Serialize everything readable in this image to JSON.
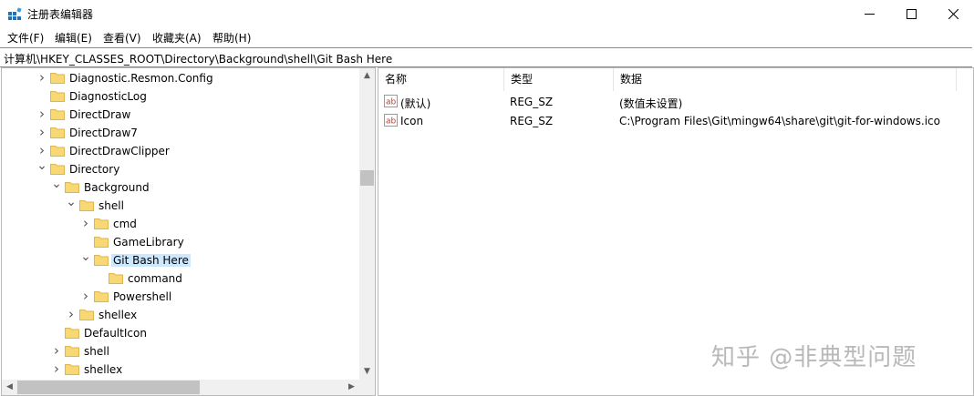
{
  "window": {
    "title": "注册表编辑器"
  },
  "menu": [
    "文件(F)",
    "编辑(E)",
    "查看(V)",
    "收藏夹(A)",
    "帮助(H)"
  ],
  "address": "计算机\\HKEY_CLASSES_ROOT\\Directory\\Background\\shell\\Git Bash Here",
  "tree": [
    {
      "label": "Diagnostic.Resmon.Config",
      "depth": 0,
      "state": "collapsed"
    },
    {
      "label": "DiagnosticLog",
      "depth": 0,
      "state": "none"
    },
    {
      "label": "DirectDraw",
      "depth": 0,
      "state": "collapsed"
    },
    {
      "label": "DirectDraw7",
      "depth": 0,
      "state": "collapsed"
    },
    {
      "label": "DirectDrawClipper",
      "depth": 0,
      "state": "collapsed"
    },
    {
      "label": "Directory",
      "depth": 0,
      "state": "expanded"
    },
    {
      "label": "Background",
      "depth": 1,
      "state": "expanded"
    },
    {
      "label": "shell",
      "depth": 2,
      "state": "expanded"
    },
    {
      "label": "cmd",
      "depth": 3,
      "state": "collapsed"
    },
    {
      "label": "GameLibrary",
      "depth": 3,
      "state": "none"
    },
    {
      "label": "Git Bash Here",
      "depth": 3,
      "state": "expanded",
      "selected": true
    },
    {
      "label": "command",
      "depth": 4,
      "state": "none"
    },
    {
      "label": "Powershell",
      "depth": 3,
      "state": "collapsed"
    },
    {
      "label": "shellex",
      "depth": 2,
      "state": "collapsed"
    },
    {
      "label": "DefaultIcon",
      "depth": 1,
      "state": "none"
    },
    {
      "label": "shell",
      "depth": 1,
      "state": "collapsed"
    },
    {
      "label": "shellex",
      "depth": 1,
      "state": "collapsed"
    }
  ],
  "list": {
    "columns": [
      "名称",
      "类型",
      "数据"
    ],
    "rows": [
      {
        "name": "(默认)",
        "type": "REG_SZ",
        "data": "(数值未设置)"
      },
      {
        "name": "Icon",
        "type": "REG_SZ",
        "data": "C:\\Program Files\\Git\\mingw64\\share\\git\\git-for-windows.ico"
      }
    ]
  },
  "watermark": "知乎 @非典型问题",
  "colors": {
    "folder": "#f8d775",
    "folder_edge": "#e0b64a",
    "selection": "#cce8ff",
    "reg_icon": "#c0392b"
  }
}
